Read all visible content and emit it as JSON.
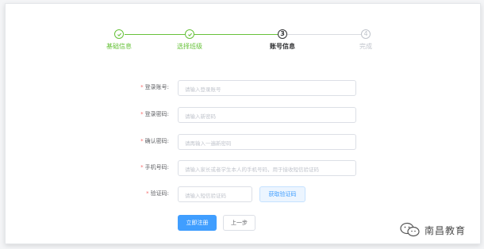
{
  "colors": {
    "success": "#67c23a",
    "primary": "#409eff",
    "danger": "#f56c6c",
    "muted": "#c0c4cc"
  },
  "steps": [
    {
      "number": "1",
      "label": "基础信息",
      "status": "done",
      "icon": "check-icon"
    },
    {
      "number": "2",
      "label": "选择班级",
      "status": "done",
      "icon": "check-icon"
    },
    {
      "number": "3",
      "label": "账号信息",
      "status": "active"
    },
    {
      "number": "4",
      "label": "完成",
      "status": "wait"
    }
  ],
  "form": {
    "required_mark": "*",
    "fields": [
      {
        "label": "登录账号:",
        "placeholder": "请输入登录账号",
        "value": ""
      },
      {
        "label": "登录密码:",
        "placeholder": "请输入新密码",
        "value": ""
      },
      {
        "label": "确认密码:",
        "placeholder": "请再输入一遍新密码",
        "value": ""
      },
      {
        "label": "手机号码:",
        "placeholder": "请输入家长或者学生本人的手机号码，用于接收短信验证码",
        "value": ""
      },
      {
        "label": "验证码:",
        "placeholder": "请输入短信验证码",
        "value": ""
      }
    ],
    "get_code_label": "获取验证码",
    "submit_label": "立即注册",
    "prev_label": "上一步"
  },
  "watermark": {
    "text": "南昌教育"
  }
}
